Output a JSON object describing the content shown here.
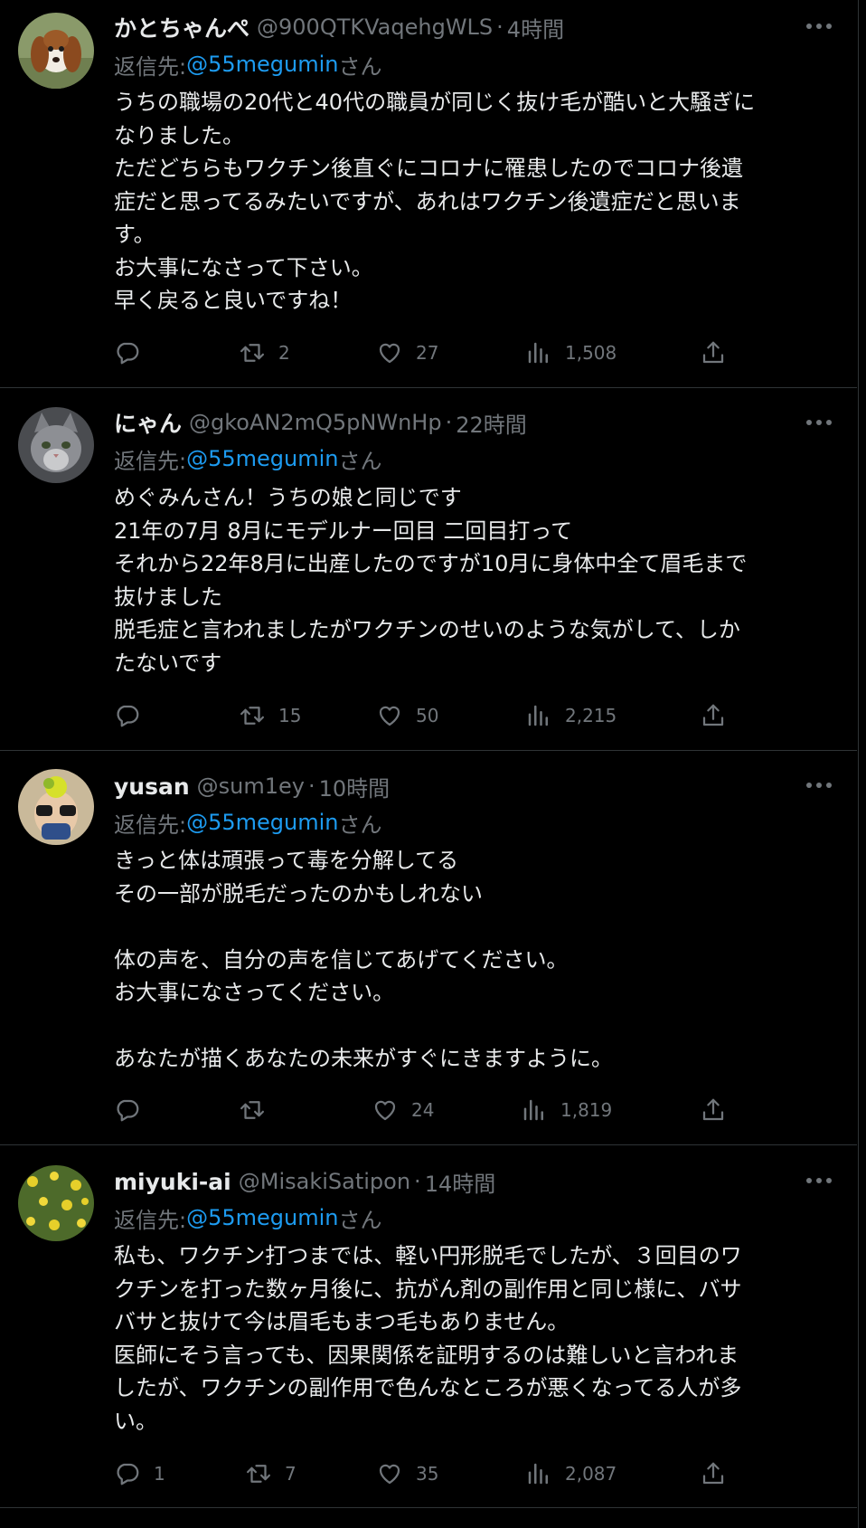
{
  "tweets": [
    {
      "display_name": "かとちゃんぺ",
      "handle": "@900QTKVaqehgWLS",
      "separator": "·",
      "time": "4時間",
      "reply_prefix": "返信先: ",
      "reply_mention": "@55megumin",
      "reply_suffix": "さん",
      "lines": [
        "うちの職場の20代と40代の職員が同じく抜け毛が酷いと大騒ぎに",
        "なりました。",
        "ただどちらもワクチン後直ぐにコロナに罹患したのでコロナ後遺",
        "症だと思ってるみたいですが、あれはワクチン後遺症だと思いま",
        "す。",
        "お大事になさって下さい。",
        "早く戻ると良いですね！"
      ],
      "replies": "",
      "retweets": "2",
      "likes": "27",
      "views": "1,508",
      "avatar_icon": "dog-avatar"
    },
    {
      "display_name": "にゃん",
      "handle": "@gkoAN2mQ5pNWnHp",
      "separator": "·",
      "time": "22時間",
      "reply_prefix": "返信先: ",
      "reply_mention": "@55megumin",
      "reply_suffix": "さん",
      "lines": [
        "めぐみんさん！うちの娘と同じです",
        "21年の7月  8月にモデルナー回目 二回目打って",
        "それから22年8月に出産したのですが10月に身体中全て眉毛まで",
        "抜けました",
        "脱毛症と言われましたがワクチンのせいのような気がして、しか",
        "たないです"
      ],
      "replies": "",
      "retweets": "15",
      "likes": "50",
      "views": "2,215",
      "avatar_icon": "cat-avatar"
    },
    {
      "display_name": "yusan",
      "handle": "@sum1ey",
      "separator": "·",
      "time": "10時間",
      "reply_prefix": "返信先: ",
      "reply_mention": "@55megumin",
      "reply_suffix": "さん",
      "lines": [
        "きっと体は頑張って毒を分解してる",
        "その一部が脱毛だったのかもしれない",
        "",
        "体の声を、自分の声を信じてあげてください。",
        "お大事になさってください。",
        "",
        "あなたが描くあなたの未来がすぐにきますように。"
      ],
      "replies": "",
      "retweets": "",
      "likes": "24",
      "views": "1,819",
      "avatar_icon": "child-avatar"
    },
    {
      "display_name": "miyuki-ai",
      "handle": "@MisakiSatipon",
      "separator": "·",
      "time": "14時間",
      "reply_prefix": "返信先: ",
      "reply_mention": "@55megumin",
      "reply_suffix": "さん",
      "lines": [
        "私も、ワクチン打つまでは、軽い円形脱毛でしたが、３回目のワ",
        "クチンを打った数ヶ月後に、抗がん剤の副作用と同じ様に、バサ",
        "バサと抜けて今は眉毛もまつ毛もありません。",
        "医師にそう言っても、因果関係を証明するのは難しいと言われま",
        "したが、ワクチンの副作用で色んなところが悪くなってる人が多",
        "い。"
      ],
      "replies": "1",
      "retweets": "7",
      "likes": "35",
      "views": "2,087",
      "avatar_icon": "flowers-avatar"
    }
  ],
  "colors": {
    "background": "#000000",
    "text": "#e7e9ea",
    "secondary": "#71767b",
    "link": "#1d9bf0",
    "border": "#2f3336"
  }
}
